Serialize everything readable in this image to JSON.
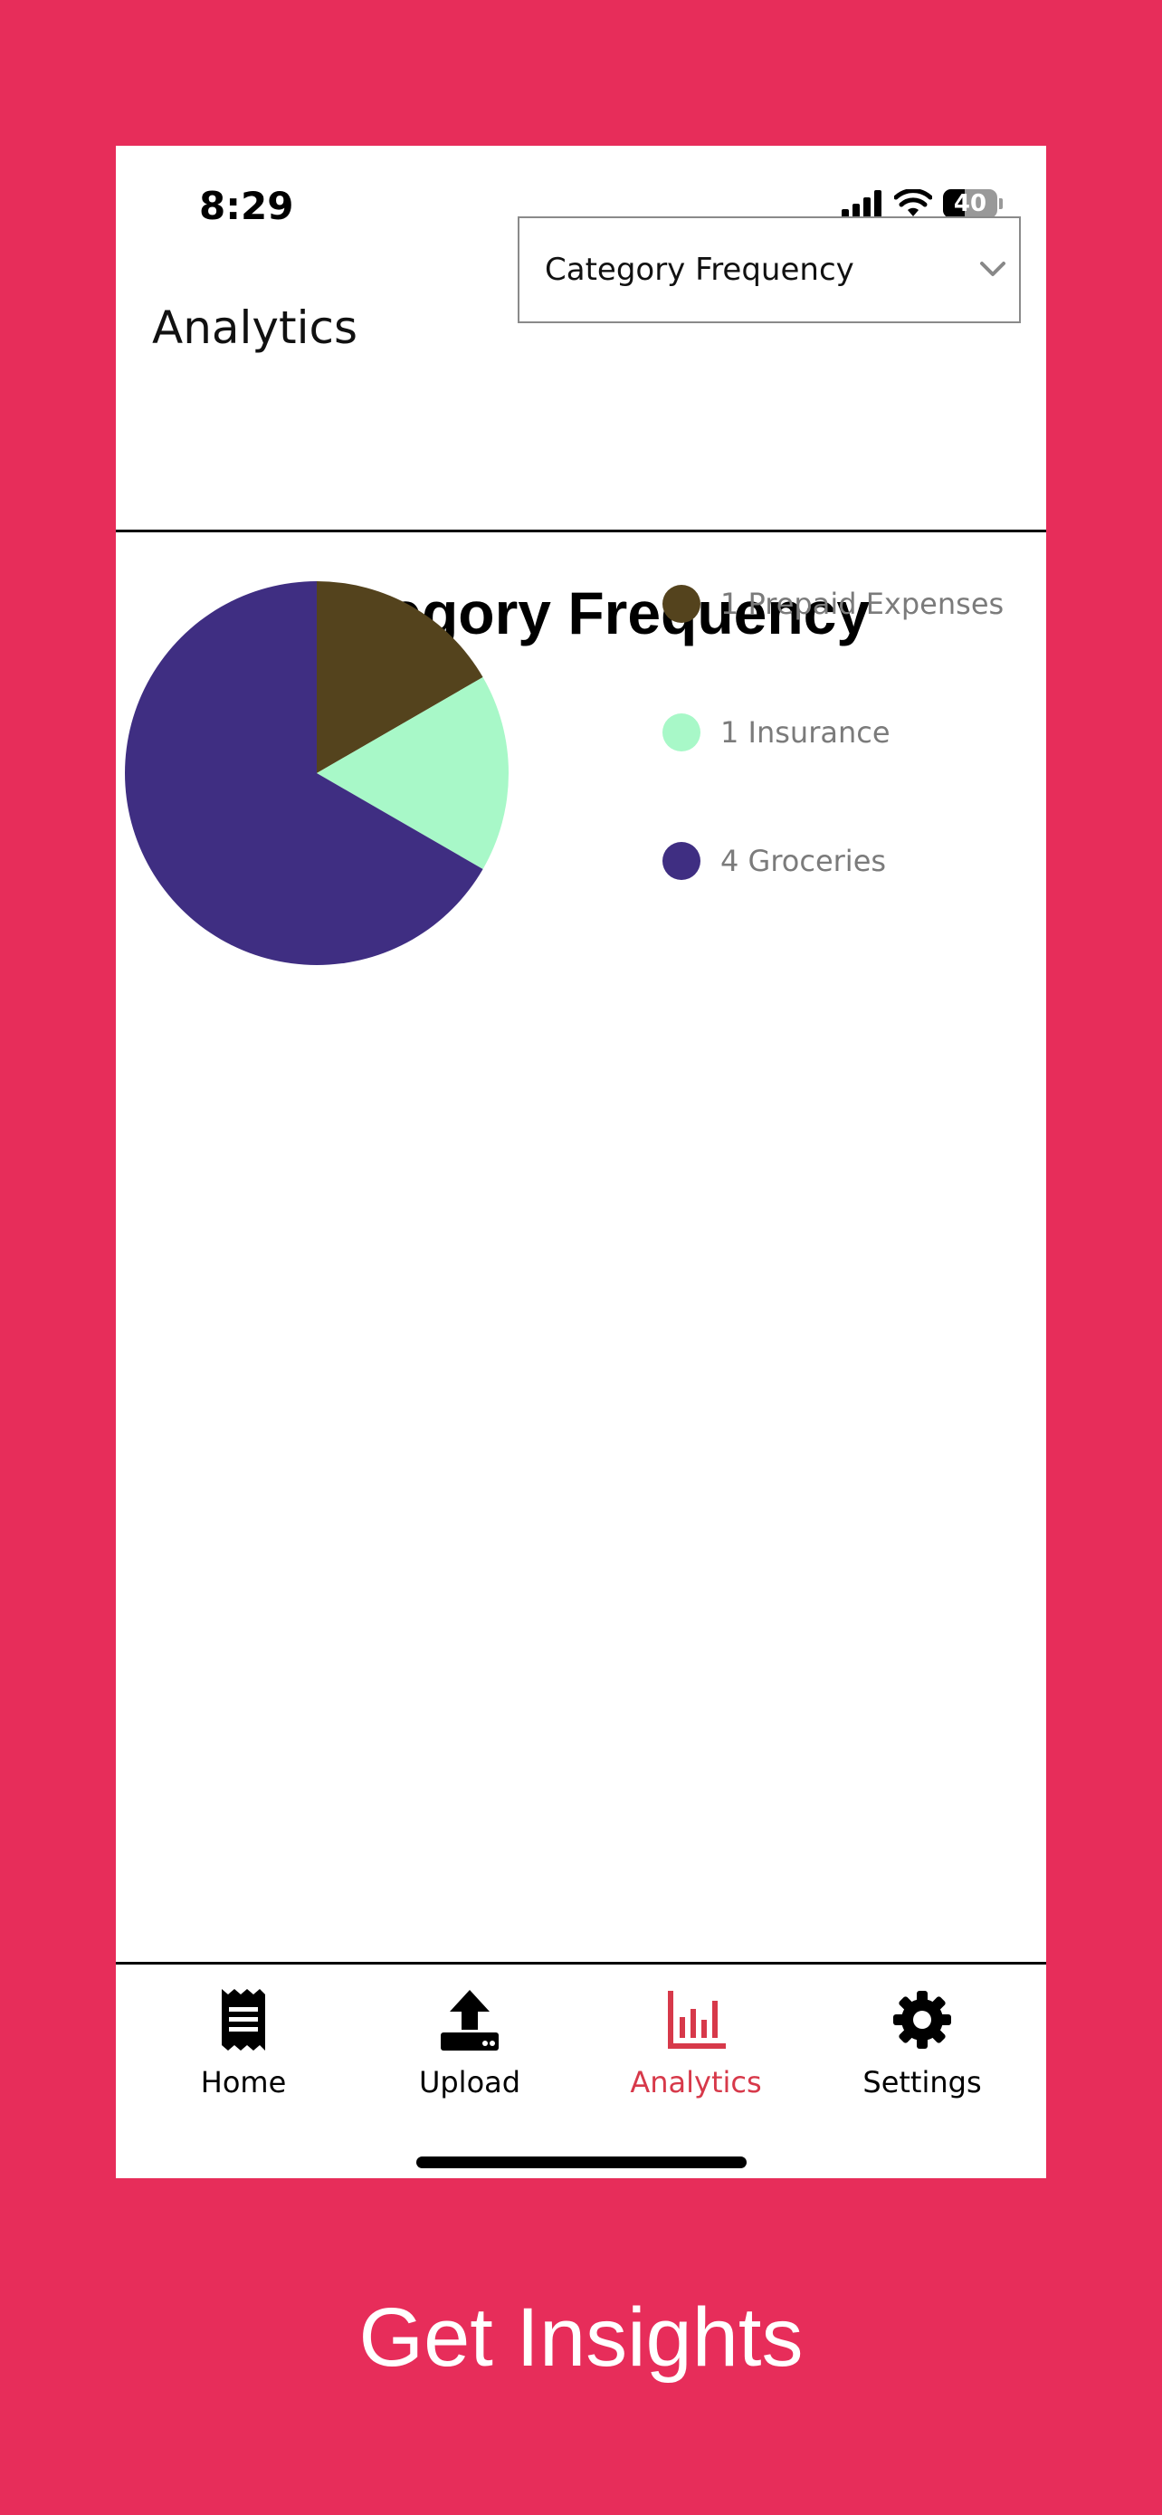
{
  "status_bar": {
    "time": "8:29",
    "battery": "40"
  },
  "header": {
    "title": "Analytics",
    "dropdown_selected": "Category Frequency"
  },
  "colors": {
    "background": "#E72D5A",
    "active_tab": "#D7394A",
    "prepaid": "#54431D",
    "insurance": "#A8F8C8",
    "groceries": "#3F2E82"
  },
  "chart_data": {
    "type": "pie",
    "title": "Category Frequency",
    "categories": [
      "Prepaid Expenses",
      "Insurance",
      "Groceries"
    ],
    "values": [
      1,
      1,
      4
    ],
    "colors": [
      "#54431D",
      "#A8F8C8",
      "#3F2E82"
    ],
    "legend_labels": [
      "1 Prepaid Expenses",
      "1 Insurance",
      "4 Groceries"
    ],
    "legend": "right"
  },
  "tabs": [
    {
      "label": "Home",
      "icon": "receipt-icon",
      "active": false
    },
    {
      "label": "Upload",
      "icon": "upload-icon",
      "active": false
    },
    {
      "label": "Analytics",
      "icon": "bar-chart-icon",
      "active": true
    },
    {
      "label": "Settings",
      "icon": "gear-icon",
      "active": false
    }
  ],
  "caption": "Get Insights"
}
